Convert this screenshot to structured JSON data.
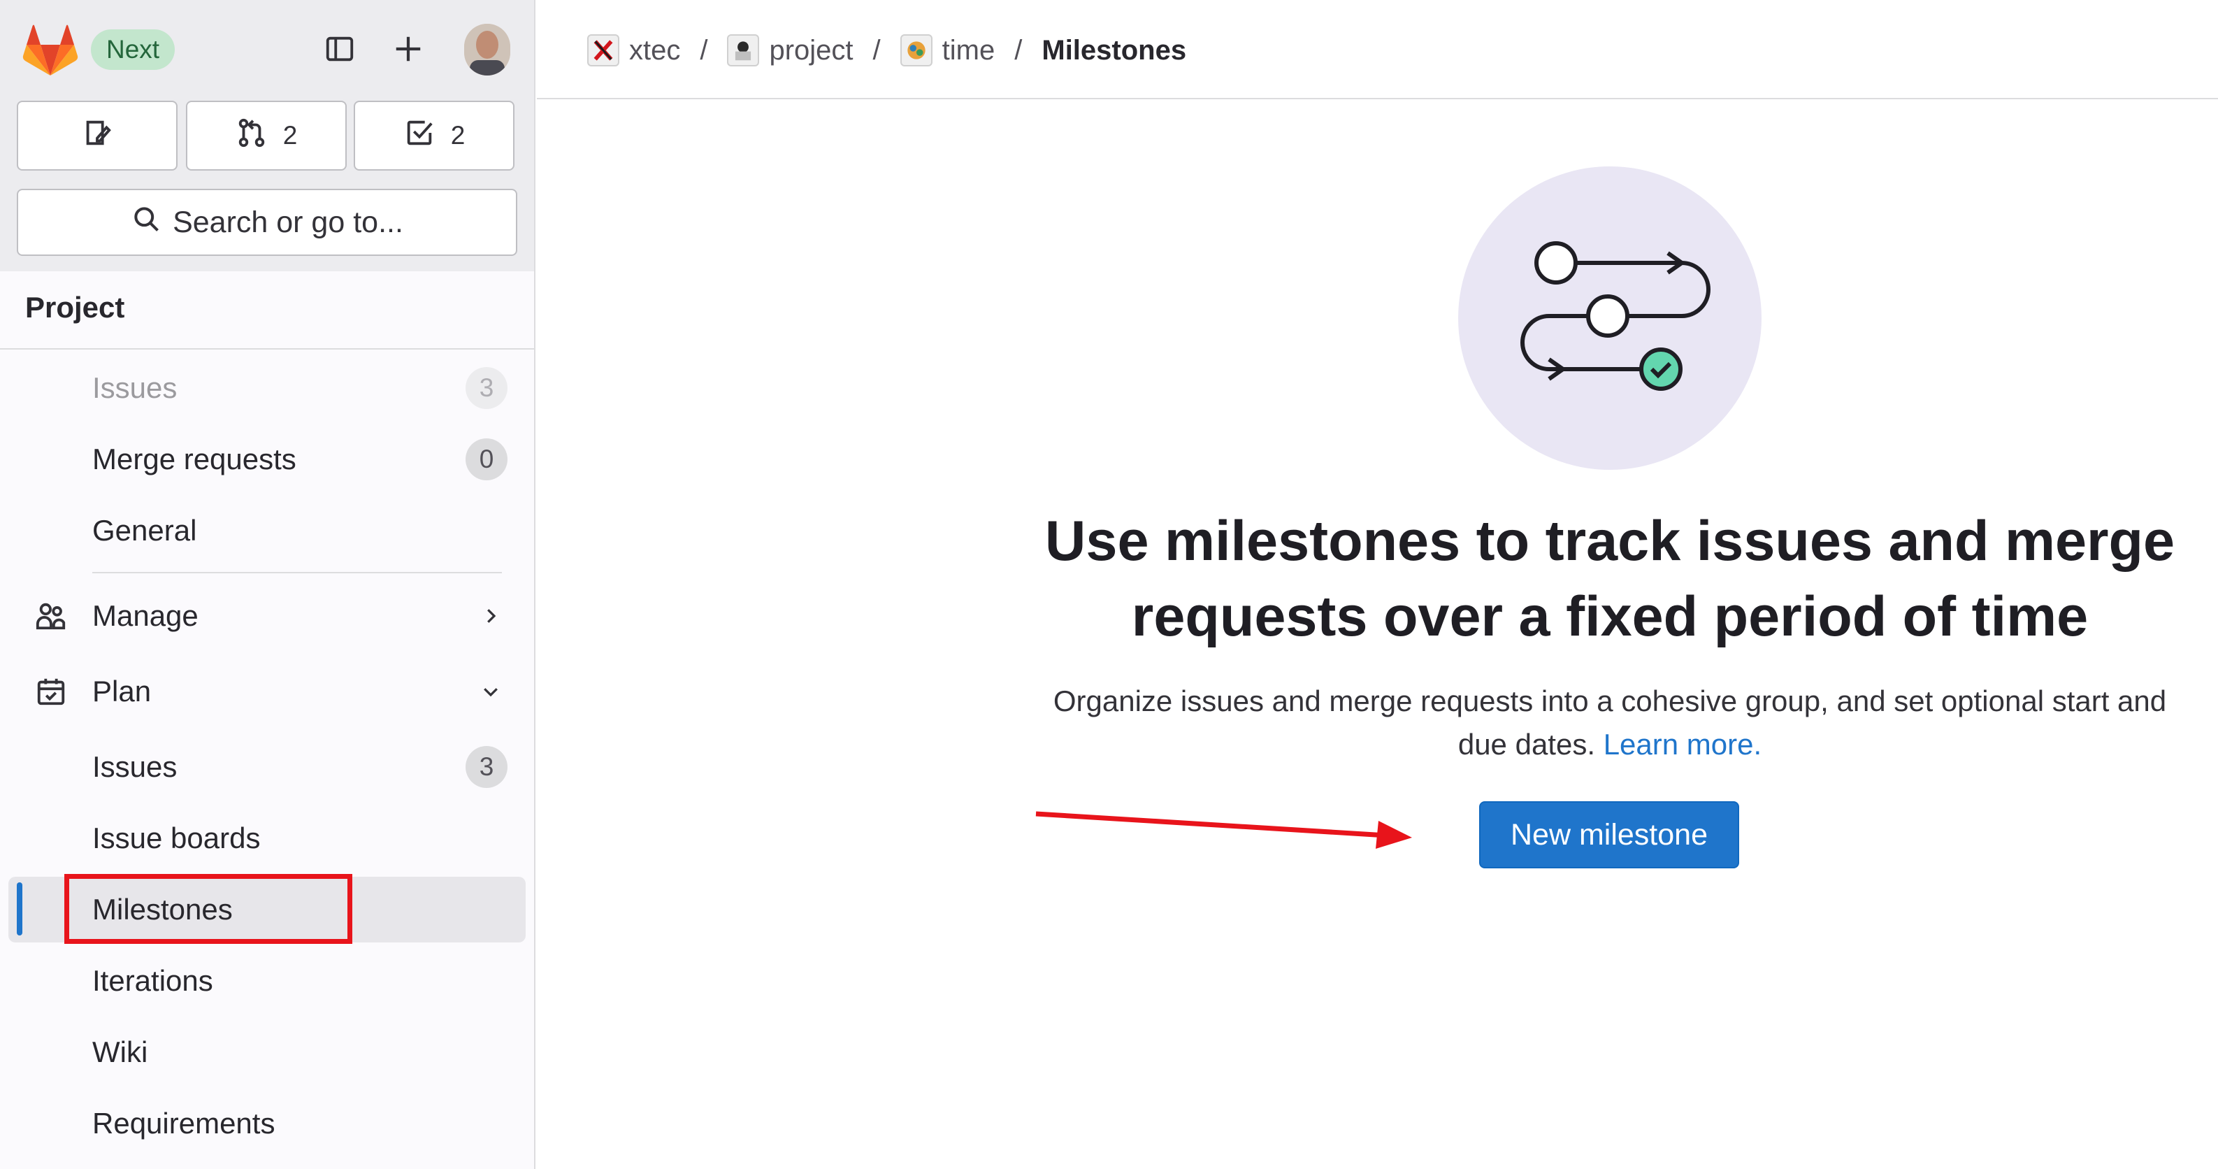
{
  "topbar": {
    "badge": "Next",
    "merge_requests_count": "2",
    "todos_count": "2",
    "search_placeholder": "Search or go to..."
  },
  "sidebar": {
    "section_title": "Project",
    "items": [
      {
        "label": "Issues",
        "count": "3"
      },
      {
        "label": "Merge requests",
        "count": "0"
      },
      {
        "label": "General"
      },
      {
        "label": "Manage"
      },
      {
        "label": "Plan"
      },
      {
        "label": "Issues",
        "count": "3"
      },
      {
        "label": "Issue boards"
      },
      {
        "label": "Milestones"
      },
      {
        "label": "Iterations"
      },
      {
        "label": "Wiki"
      },
      {
        "label": "Requirements"
      }
    ]
  },
  "breadcrumb": {
    "items": [
      "xtec",
      "project",
      "time"
    ],
    "current": "Milestones",
    "separator": "/"
  },
  "empty_state": {
    "title": "Use milestones to track issues and merge requests over a fixed period of time",
    "description": "Organize issues and merge requests into a cohesive group, and set optional start and due dates.",
    "learn_more": "Learn more.",
    "button_label": "New milestone"
  },
  "colors": {
    "accent": "#1f75cb",
    "annotation": "#e8141b",
    "badge_bg": "#c3e6cd",
    "illustration_bg": "#e9e6f4",
    "check_green": "#63d6ae"
  },
  "icons": [
    "gitlab-logo",
    "sidebar-toggle-icon",
    "plus-icon",
    "issues-icon",
    "merge-request-icon",
    "todo-icon",
    "search-icon",
    "users-icon",
    "calendar-icon",
    "chevron-right-icon",
    "chevron-down-icon",
    "milestone-illustration"
  ]
}
